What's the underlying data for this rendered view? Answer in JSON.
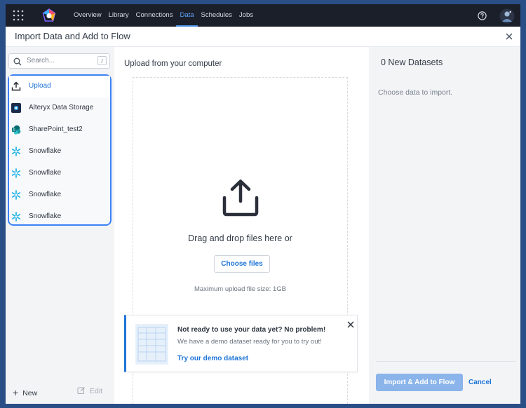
{
  "nav": {
    "items": [
      "Overview",
      "Library",
      "Connections",
      "Data",
      "Schedules",
      "Jobs"
    ],
    "active": "Data"
  },
  "dialog": {
    "title": "Import Data and Add to Flow"
  },
  "sidebar": {
    "search_placeholder": "Search...",
    "search_shortcut": "/",
    "items": [
      {
        "label": "Upload",
        "icon": "upload-icon"
      },
      {
        "label": "Alteryx Data Storage",
        "icon": "alteryx-storage-icon"
      },
      {
        "label": "SharePoint_test2",
        "icon": "sharepoint-icon"
      },
      {
        "label": "Snowflake",
        "icon": "snowflake-icon"
      },
      {
        "label": "Snowflake",
        "icon": "snowflake-icon"
      },
      {
        "label": "Snowflake",
        "icon": "snowflake-icon"
      },
      {
        "label": "Snowflake",
        "icon": "snowflake-icon"
      }
    ],
    "new_label": "New",
    "edit_label": "Edit"
  },
  "upload": {
    "title": "Upload from your computer",
    "drag_text": "Drag and drop files here or",
    "choose_label": "Choose files",
    "max_size": "Maximum upload file size: 1GB"
  },
  "demo": {
    "title": "Not ready to use your data yet? No problem!",
    "subtitle": "We have a demo dataset ready for you to try out!",
    "link": "Try our demo dataset"
  },
  "right": {
    "title": "0 New Datasets",
    "empty": "Choose data to import.",
    "import_label": "Import & Add to Flow",
    "cancel_label": "Cancel"
  },
  "colors": {
    "accent": "#1d74d8",
    "topbar": "#1b1f2a",
    "selection_border": "#3b82f6",
    "disabled_button": "#8ab4ea"
  }
}
